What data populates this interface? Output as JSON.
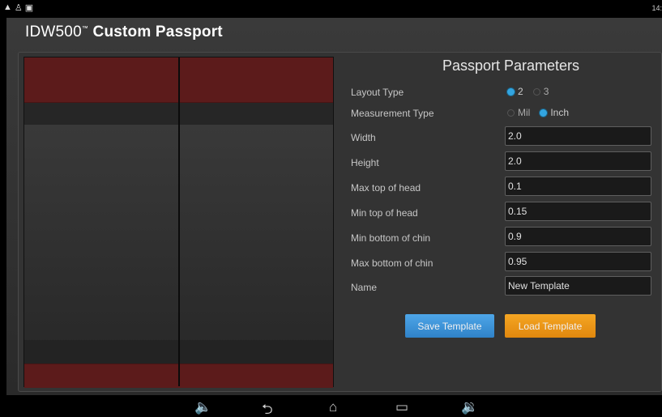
{
  "status_bar": {
    "icons": [
      "alert-icon",
      "usb-icon",
      "image-icon"
    ],
    "icon_glyphs": [
      "▲",
      "♙",
      "▣"
    ],
    "time": "14:"
  },
  "app": {
    "title_prefix": "IDW500",
    "title_tm": "™",
    "title_bold": "Custom Passport"
  },
  "params": {
    "title": "Passport Parameters",
    "layout_type": {
      "label": "Layout Type",
      "options": [
        "2",
        "3"
      ],
      "selected": "2"
    },
    "measurement_type": {
      "label": "Measurement Type",
      "options": [
        "Mil",
        "Inch"
      ],
      "selected": "Inch"
    },
    "fields": [
      {
        "label": "Width",
        "value": "2.0"
      },
      {
        "label": "Height",
        "value": "2.0"
      },
      {
        "label": "Max top of head",
        "value": "0.1"
      },
      {
        "label": "Min top of head",
        "value": "0.15"
      },
      {
        "label": "Min bottom of chin",
        "value": "0.9"
      },
      {
        "label": "Max bottom of chin",
        "value": "0.95"
      },
      {
        "label": "Name",
        "value": "New Template"
      }
    ],
    "save_label": "Save Template",
    "load_label": "Load Template"
  },
  "nav_bar": {
    "buttons": [
      {
        "name": "volume-down-icon",
        "glyph": "🔈"
      },
      {
        "name": "back-icon",
        "glyph": "⮌"
      },
      {
        "name": "home-icon",
        "glyph": "⌂"
      },
      {
        "name": "recent-apps-icon",
        "glyph": "▭"
      },
      {
        "name": "volume-up-icon",
        "glyph": "🔉"
      }
    ]
  },
  "colors": {
    "accent_blue": "#33a5e0",
    "save_button": "#3a92d8",
    "load_button": "#eb9718",
    "guide_red": "#5c1b1b"
  }
}
